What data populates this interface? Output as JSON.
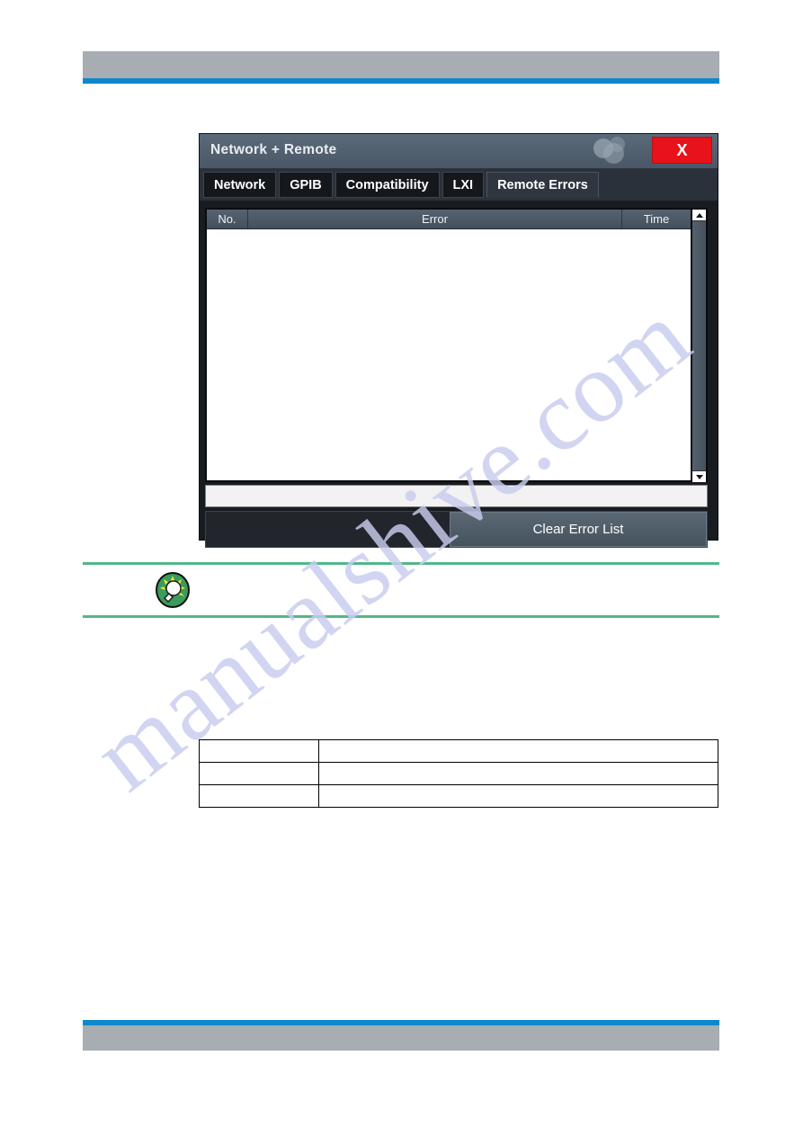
{
  "page": {
    "header_bar_color": "#a7adb2",
    "accent_rule_color": "#0e88cc",
    "watermark_text": "manualshive.com"
  },
  "dialog": {
    "title": "Network + Remote",
    "close_label": "X",
    "tabs": [
      {
        "label": "Network",
        "active": false
      },
      {
        "label": "GPIB",
        "active": false
      },
      {
        "label": "Compatibility",
        "active": false
      },
      {
        "label": "LXI",
        "active": false
      },
      {
        "label": "Remote Errors",
        "active": true
      }
    ],
    "error_table": {
      "columns": [
        "No.",
        "Error",
        "Time"
      ],
      "rows": []
    },
    "status_field": {
      "value": "",
      "placeholder": ""
    },
    "clear_button_label": "Clear Error List",
    "scrollbar": {
      "up_arrow": "scroll-up-arrow",
      "down_arrow": "scroll-down-arrow"
    },
    "colors": {
      "titlebar": "#4a5765",
      "close_red": "#e8131a",
      "tab_active": "#2f3640",
      "tab_inactive": "#14171c",
      "header_row": "#4d5967",
      "button": "#4f5c68",
      "body_dark": "#22262c"
    }
  },
  "tip_callout": {
    "icon": "lightbulb-tip-icon",
    "rule_color": "#52b788",
    "text": ""
  },
  "doc_table": {
    "rows": [
      {
        "col_a": "",
        "col_b": ""
      },
      {
        "col_a": "",
        "col_b": ""
      },
      {
        "col_a": "",
        "col_b": ""
      }
    ]
  }
}
